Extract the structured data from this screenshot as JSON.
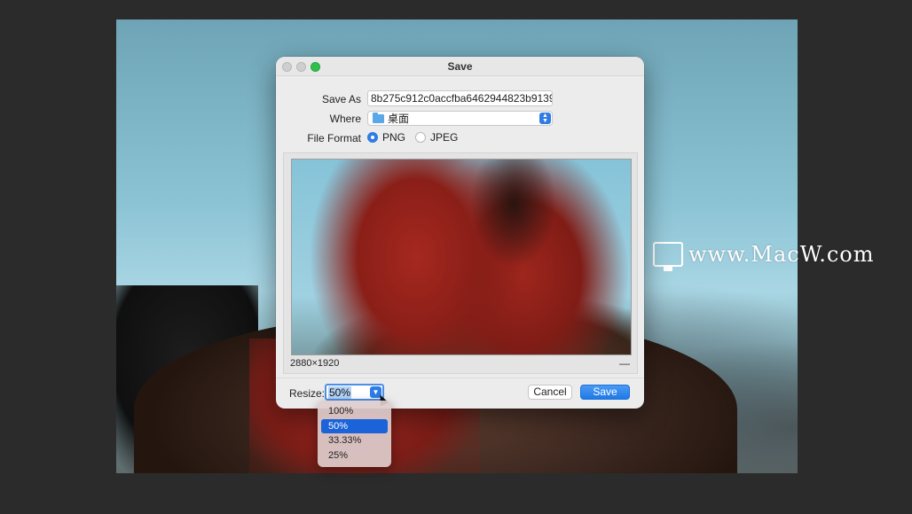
{
  "dialog": {
    "title": "Save",
    "save_as_label": "Save As",
    "save_as_value": "8b275c912c0accfba6462944823b9139.p",
    "where_label": "Where",
    "where_value": "桌面",
    "file_format_label": "File Format",
    "formats": [
      {
        "label": "PNG",
        "selected": true
      },
      {
        "label": "JPEG",
        "selected": false
      }
    ],
    "preview_dimensions": "2880×1920",
    "collapse_symbol": "—",
    "resize_label": "Resize:",
    "resize_value": "50%",
    "cancel_label": "Cancel",
    "save_label": "Save"
  },
  "resize_menu": {
    "options": [
      {
        "label": "100%",
        "selected": false
      },
      {
        "label": "50%",
        "selected": true
      },
      {
        "label": "33.33%",
        "selected": false
      },
      {
        "label": "25%",
        "selected": false
      }
    ]
  },
  "watermark": {
    "text": "www.MacW.com"
  },
  "icons": {
    "window_close": "close-icon",
    "window_minimize": "minimize-icon",
    "window_zoom": "zoom-icon",
    "folder": "folder-icon",
    "popup": "chevron-updown-icon",
    "combo": "chevron-down-icon",
    "watermark_logo": "monitor-icon"
  },
  "colors": {
    "accent": "#2f7ce6",
    "zoom_button": "#2ec14a",
    "menu_highlight": "#1a63d8"
  }
}
